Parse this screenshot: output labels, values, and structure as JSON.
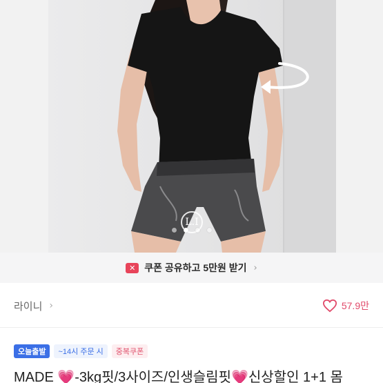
{
  "product_image": {
    "description_icon": "rotate-arrow-icon",
    "carousel_total": 4,
    "carousel_active": 2,
    "watermark_text": "L.I"
  },
  "coupon_banner": {
    "icon": "coupon-icon",
    "text": "쿠폰 공유하고 5만원 받기",
    "chevron": "›"
  },
  "store": {
    "name": "라이니",
    "chevron": "›",
    "likes": "57.9만",
    "heart_color": "#e14a6a"
  },
  "badges": [
    {
      "label": "오늘출발"
    },
    {
      "label": "~14시 주문 시"
    },
    {
      "label": "중복쿠폰"
    }
  ],
  "title": {
    "text": "MADE 💗-3kg핏/3사이즈/인생슬림핏💗신상할인 1+1 몸"
  },
  "colors": {
    "accent_blue": "#3b6fe6",
    "accent_pink": "#e14a6a",
    "coupon_red": "#e8445a"
  }
}
